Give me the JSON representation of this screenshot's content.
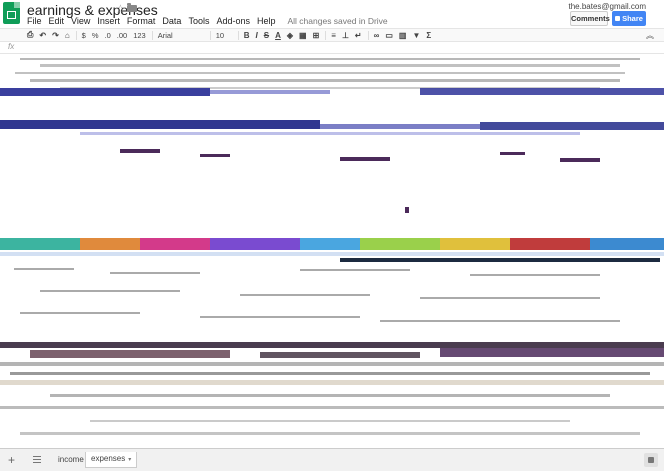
{
  "header": {
    "title": "earnings & expenses",
    "user_email": "the.bates@gmail.com",
    "save_status": "All changes saved in Drive",
    "comments_label": "Comments",
    "share_label": "Share"
  },
  "menu": [
    "File",
    "Edit",
    "View",
    "Insert",
    "Format",
    "Data",
    "Tools",
    "Add-ons",
    "Help"
  ],
  "toolbar": {
    "currency": "$",
    "percent": "%",
    "decimal_less": ".0",
    "decimal_more": ".00",
    "number_format": "123",
    "font": "Arial",
    "font_size": "10",
    "bold": "B",
    "italic": "I",
    "strike": "S",
    "text_color": "A"
  },
  "formula_bar": {
    "fx": "fx"
  },
  "sheets": [
    {
      "label": "income",
      "active": false
    },
    {
      "label": "expenses",
      "active": true
    }
  ],
  "colors": {
    "brand_green": "#0f9d58",
    "share_blue": "#4285f4",
    "glitch_blue": "#3a3f9e",
    "glitch_purple": "#4b2a5a"
  },
  "icons": [
    "star-icon",
    "folder-icon",
    "share-icon",
    "fx-icon",
    "add-sheet-icon",
    "sheet-list-icon",
    "explore-icon"
  ]
}
